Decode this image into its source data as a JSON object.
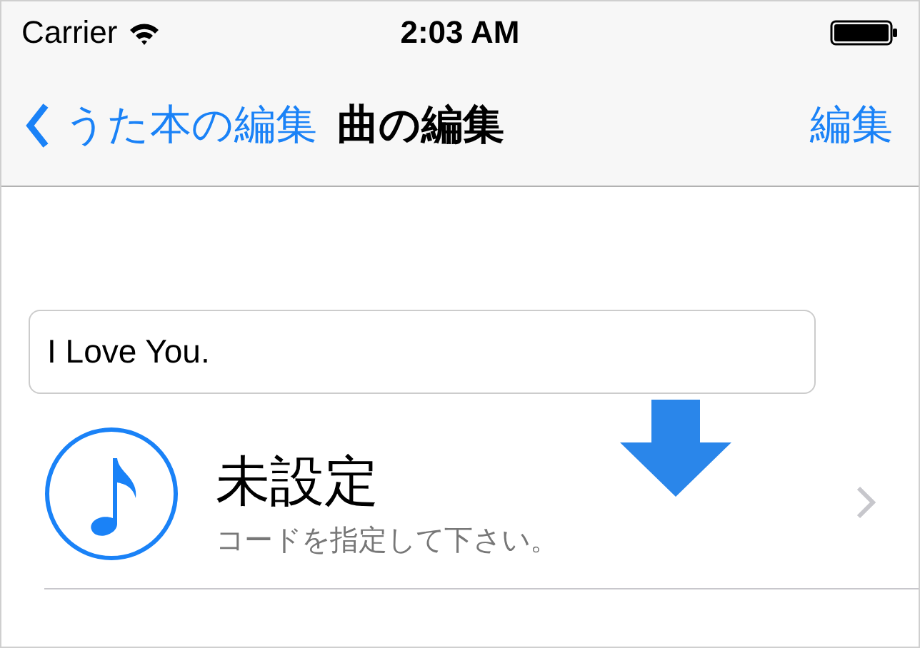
{
  "status_bar": {
    "carrier": "Carrier",
    "time": "2:03 AM"
  },
  "nav_bar": {
    "back_label": "うた本の編集",
    "title": "曲の編集",
    "action": "編集"
  },
  "song_title_field": {
    "value": "I Love You."
  },
  "chord_row": {
    "title": "未設定",
    "subtitle": "コードを指定して下さい。"
  }
}
